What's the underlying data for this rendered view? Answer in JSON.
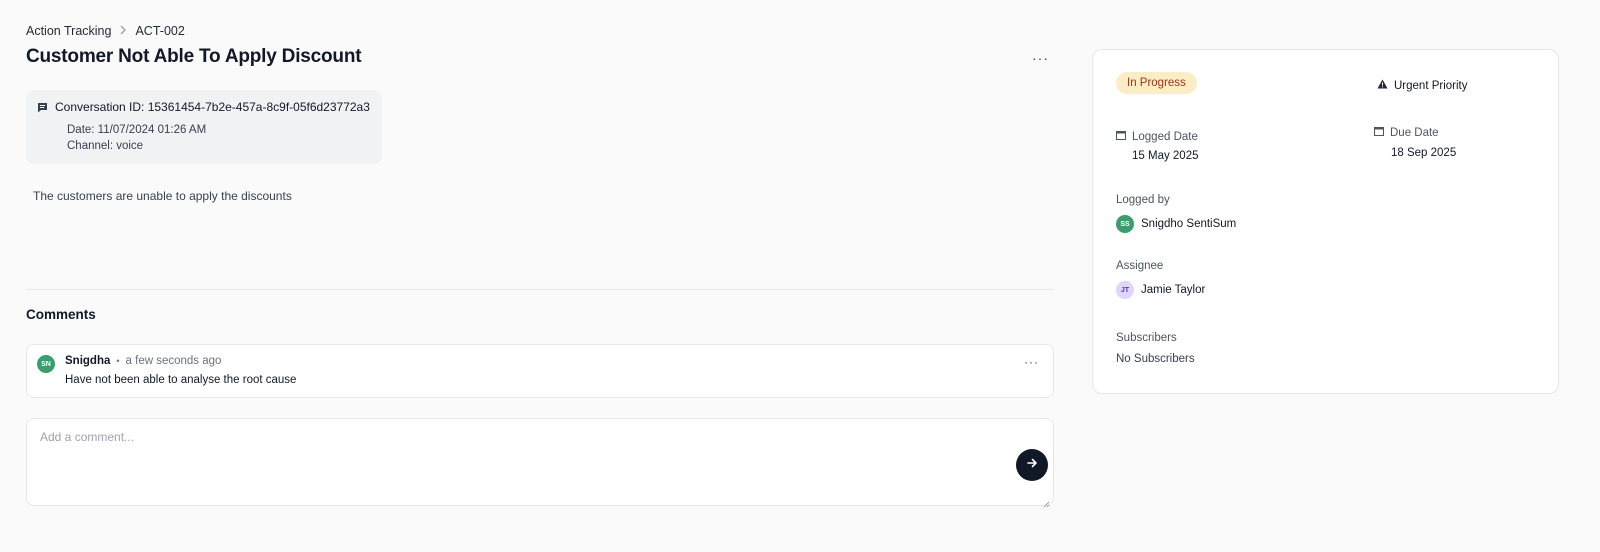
{
  "breadcrumb": {
    "root": "Action Tracking",
    "current": "ACT-002"
  },
  "title": "Customer Not Able To Apply Discount",
  "more_label": "···",
  "conversation": {
    "id_text": "Conversation ID: 15361454-7b2e-457a-8c9f-05f6d23772a3",
    "date_text": "Date: 11/07/2024 01:26 AM",
    "channel_text": "Channel: voice"
  },
  "description": "The customers are unable to apply the discounts",
  "comments": {
    "heading": "Comments",
    "items": [
      {
        "initials": "SN",
        "author": "Snigdha",
        "time": "a few seconds ago",
        "body": "Have not been able to analyse the root cause"
      }
    ],
    "input_placeholder": "Add a comment..."
  },
  "details": {
    "status": "In Progress",
    "priority": "Urgent Priority",
    "logged_date_label": "Logged Date",
    "logged_date": "15 May 2025",
    "due_date_label": "Due Date",
    "due_date": "18 Sep 2025",
    "logged_by_label": "Logged by",
    "logged_by": {
      "initials": "SS",
      "name": "Snigdho SentiSum"
    },
    "assignee_label": "Assignee",
    "assignee": {
      "initials": "JT",
      "name": "Jamie Taylor"
    },
    "subscribers_label": "Subscribers",
    "subscribers_value": "No Subscribers"
  },
  "colors": {
    "status_bg": "#fdedc6",
    "status_text": "#9a3412",
    "avatar_green": "#3a9d6d",
    "avatar_purple": "#ddd6fe",
    "send_button": "#111827"
  },
  "icons": {
    "breadcrumb_separator": "chevron-right-icon",
    "conversation": "chat-icon",
    "priority": "warning-triangle-icon",
    "date": "calendar-icon",
    "send": "arrow-right-icon",
    "more": "more-horizontal-icon"
  }
}
